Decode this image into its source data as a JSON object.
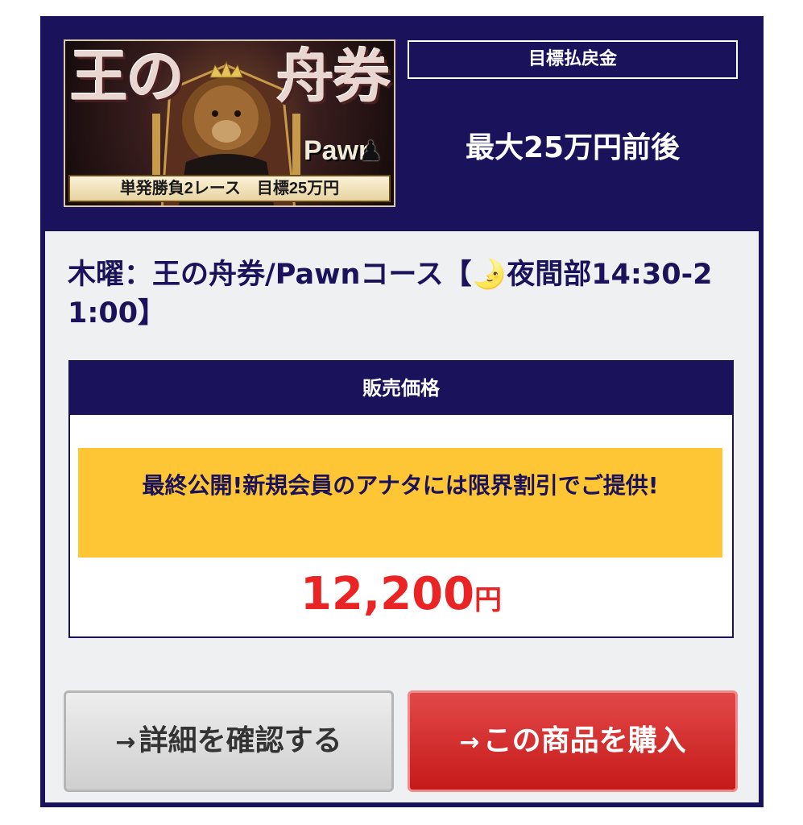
{
  "banner": {
    "title_part1": "王の",
    "title_part2": "舟券",
    "logo_text": "Pawn",
    "piece_icon": "chess-pawn-icon",
    "strip_text": "単発勝負2レース　目標25万円"
  },
  "target": {
    "label": "目標払戻金",
    "value": "最大25万円前後"
  },
  "course": {
    "title": "木曜：王の舟券/Pawnコース【🌛夜間部14:30-21:00】"
  },
  "price_box": {
    "heading": "販売価格",
    "promo": "最終公開!新規会員のアナタには限界割引でご提供!",
    "amount": "12,200",
    "unit": "円"
  },
  "buttons": {
    "arrow": "→",
    "detail_label": "詳細を確認する",
    "buy_label": "この商品を購入"
  },
  "colors": {
    "navy": "#1a125a",
    "promo_yellow": "#fec534",
    "price_red": "#ea2424",
    "buy_red": "#d42e2e"
  }
}
